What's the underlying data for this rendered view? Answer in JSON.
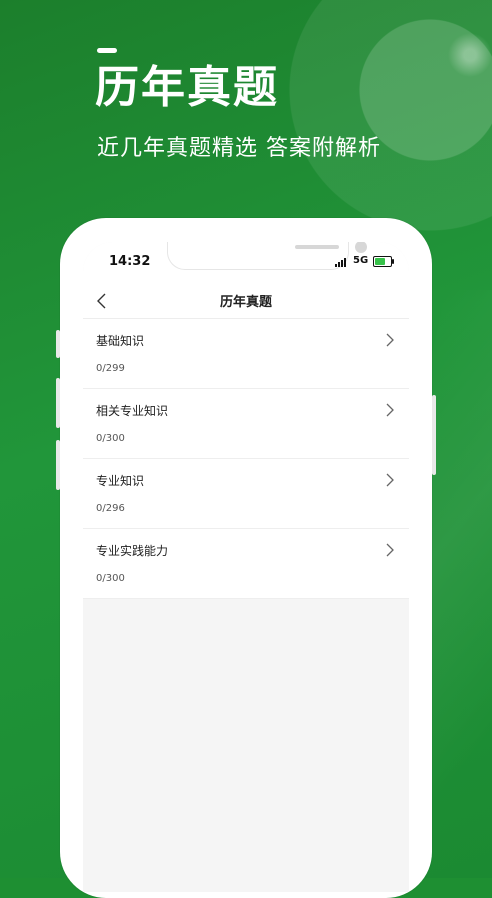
{
  "promo": {
    "title": "历年真题",
    "subtitle": "近几年真题精选 答案附解析"
  },
  "status_bar": {
    "time": "14:32",
    "network": "5G"
  },
  "nav": {
    "title": "历年真题"
  },
  "subjects": [
    {
      "name": "基础知识",
      "progress": "0/299"
    },
    {
      "name": "相关专业知识",
      "progress": "0/300"
    },
    {
      "name": "专业知识",
      "progress": "0/296"
    },
    {
      "name": "专业实践能力",
      "progress": "0/300"
    }
  ],
  "colors": {
    "brand_green": "#1e8f32",
    "battery_green": "#37c24a"
  },
  "icons": [
    "back-arrow-icon",
    "chevron-right-icon",
    "signal-icon",
    "battery-icon"
  ]
}
